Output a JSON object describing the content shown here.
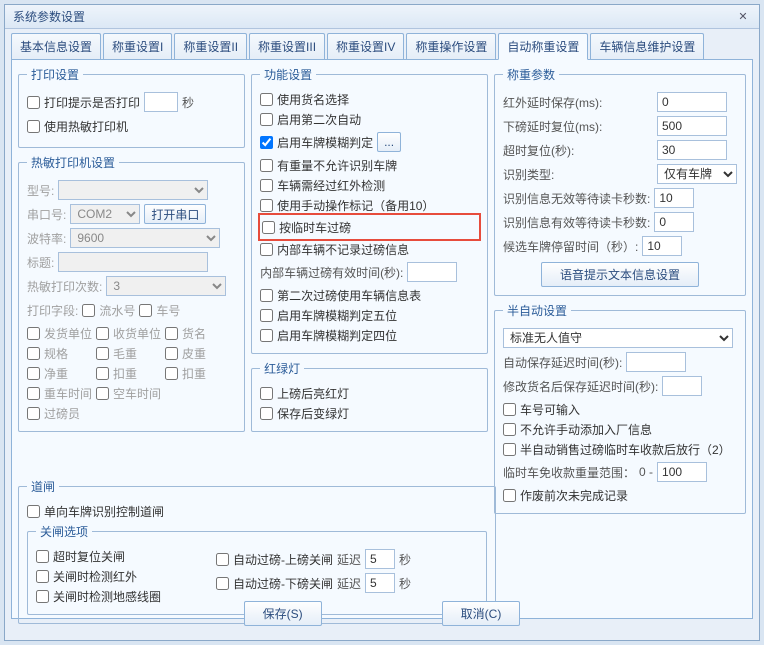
{
  "window": {
    "title": "系统参数设置",
    "close": "✕"
  },
  "tabs": [
    "基本信息设置",
    "称重设置I",
    "称重设置II",
    "称重设置III",
    "称重设置IV",
    "称重操作设置",
    "自动称重设置",
    "车辆信息维护设置"
  ],
  "activeTab": 6,
  "print": {
    "legend": "打印设置",
    "opt_prompt": "打印提示是否打印",
    "sec": "秒",
    "opt_thermal": "使用热敏打印机"
  },
  "thermal": {
    "legend": "热敏打印机设置",
    "model": "型号:",
    "port": "串口号:",
    "port_val": "COM2",
    "open": "打开串口",
    "baud": "波特率:",
    "baud_val": "9600",
    "title": "标题:",
    "count": "热敏打印次数:",
    "count_val": "3",
    "fields": "打印字段:",
    "f_flow": "流水号",
    "f_car": "车号",
    "f_ship": "发货单位",
    "f_recv": "收货单位",
    "f_goods": "货名",
    "f_spec": "规格",
    "f_gross": "毛重",
    "f_tare": "皮重",
    "f_net": "净重",
    "f_kou": "扣重",
    "f_kou2": "扣重",
    "f_hcar": "重车时间",
    "f_empty": "空车时间",
    "f_op": "过磅员"
  },
  "func": {
    "legend": "功能设置",
    "f1": "使用货名选择",
    "f2": "启用第二次自动",
    "f3": "启用车牌模糊判定",
    "f3btn": "...",
    "f4": "有重量不允许识别车牌",
    "f5": "车辆需经过红外检测",
    "f6": "使用手动操作标记（备用10）",
    "f7": "按临时车过磅",
    "f8": "内部车辆不记录过磅信息",
    "f9lab": "内部车辆过磅有效时间(秒):",
    "f10": "第二次过磅使用车辆信息表",
    "f11": "启用车牌模糊判定五位",
    "f12": "启用车牌模糊判定四位"
  },
  "light": {
    "legend": "红绿灯",
    "l1": "上磅后亮红灯",
    "l2": "保存后变绿灯"
  },
  "gate": {
    "legend": "道闸",
    "g1": "单向车牌识别控制道闸",
    "close_legend": "关闸选项",
    "c1": "超时复位关闸",
    "c2": "关闸时检测红外",
    "c3": "关闸时检测地感线圈",
    "a1": "自动过磅-上磅关闸",
    "a2": "自动过磅-下磅关闸",
    "delay": "延迟",
    "sec": "秒",
    "d1": "5",
    "d2": "5"
  },
  "weigh": {
    "legend": "称重参数",
    "p1": "红外延时保存(ms):",
    "v1": "0",
    "p2": "下磅延时复位(ms):",
    "v2": "500",
    "p3": "超时复位(秒):",
    "v3": "30",
    "p4": "识别类型:",
    "v4": "仅有车牌",
    "p5": "识别信息无效等待读卡秒数:",
    "v5": "10",
    "p6": "识别信息有效等待读卡秒数:",
    "v6": "0",
    "p7": "候选车牌停留时间（秒）:",
    "v7": "10",
    "voicebtn": "语音提示文本信息设置"
  },
  "semi": {
    "legend": "半自动设置",
    "mode": "标准无人值守",
    "s1": "自动保存延迟时间(秒):",
    "s2": "修改货名后保存延迟时间(秒):",
    "c1": "车号可输入",
    "c2": "不允许手动添加入厂信息",
    "c3": "半自动销售过磅临时车收款后放行（2）",
    "range": "临时车免收款重量范围：",
    "zero": "0 -",
    "rv": "100",
    "c4": "作废前次未完成记录"
  },
  "footer": {
    "save": "保存(S)",
    "cancel": "取消(C)"
  }
}
